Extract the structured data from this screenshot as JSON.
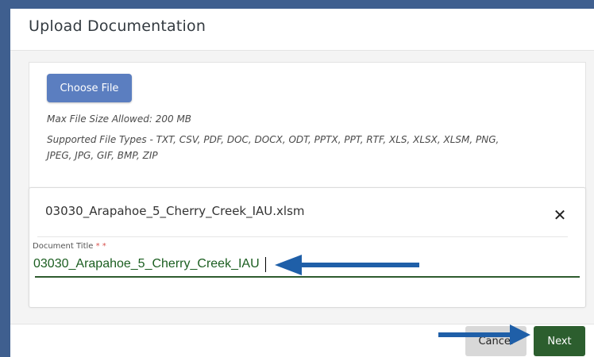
{
  "modal": {
    "title": "Upload Documentation"
  },
  "upload": {
    "choose_label": "Choose File",
    "max_size": "Max File Size Allowed: 200 MB",
    "types_line1": "Supported File Types - TXT, CSV, PDF, DOC, DOCX, ODT, PPTX, PPT, RTF, XLS, XLSX, XLSM, PNG,",
    "types_line2": "JPEG, JPG, GIF, BMP, ZIP"
  },
  "file": {
    "name": "03030_Arapahoe_5_Cherry_Creek_IAU.xlsm",
    "remove_glyph": "✕",
    "title_label": "Document Title",
    "required_marks": "* *",
    "title_value": "03030_Arapahoe_5_Cherry_Creek_IAU"
  },
  "footer": {
    "cancel_label": "Cancel",
    "next_label": "Next"
  },
  "colors": {
    "frame": "#3f5f8f",
    "choose_button": "#5b7ec0",
    "next_button": "#2c5e2e",
    "input_text": "#1b5e20",
    "required": "#d9534f",
    "annotation_arrow": "#1f5fa8"
  }
}
